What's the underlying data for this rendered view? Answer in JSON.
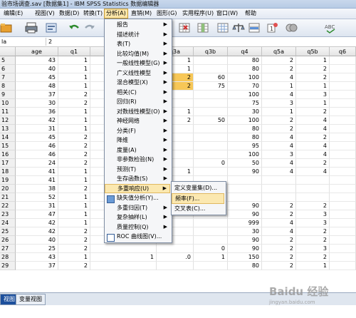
{
  "window": {
    "title": "验市场调查.sav [数据集1] - IBM SPSS Statistics 数据编辑器"
  },
  "menubar": [
    "编辑(E)",
    "视图(V)",
    "数据(D)",
    "转换(T)",
    "分析(A)",
    "直销(M)",
    "图形(G)",
    "实用程序(U)",
    "窗口(W)",
    "帮助"
  ],
  "cell_editor": {
    "name": "la",
    "value": "2"
  },
  "columns": [
    "age",
    "q1",
    "",
    "q3a",
    "q3b",
    "q4",
    "q5a",
    "q5b",
    "q6"
  ],
  "rows": [
    {
      "n": "5",
      "v": [
        "43",
        "1",
        "",
        "1",
        "",
        "80",
        "2",
        "1",
        ""
      ]
    },
    {
      "n": "6",
      "v": [
        "40",
        "1",
        "",
        "1",
        "",
        "80",
        "2",
        "2",
        ""
      ]
    },
    {
      "n": "7",
      "v": [
        "45",
        "1",
        "",
        "2",
        "60",
        "100",
        "4",
        "2",
        ""
      ]
    },
    {
      "n": "8",
      "v": [
        "48",
        "1",
        "",
        "2",
        "75",
        "70",
        "1",
        "1",
        ""
      ]
    },
    {
      "n": "9",
      "v": [
        "37",
        "2",
        "",
        "",
        "",
        "100",
        "4",
        "3",
        ""
      ]
    },
    {
      "n": "10",
      "v": [
        "30",
        "2",
        "",
        "",
        "",
        "75",
        "3",
        "1",
        ""
      ]
    },
    {
      "n": "11",
      "v": [
        "36",
        "1",
        "",
        "1",
        "",
        "30",
        "1",
        "2",
        ""
      ]
    },
    {
      "n": "12",
      "v": [
        "42",
        "1",
        "",
        "2",
        "50",
        "100",
        "2",
        "4",
        ""
      ]
    },
    {
      "n": "13",
      "v": [
        "31",
        "1",
        "",
        "",
        "",
        "80",
        "2",
        "4",
        ""
      ]
    },
    {
      "n": "14",
      "v": [
        "45",
        "2",
        "",
        "",
        "",
        "80",
        "4",
        "2",
        ""
      ]
    },
    {
      "n": "15",
      "v": [
        "46",
        "2",
        "",
        "",
        "",
        "95",
        "4",
        "4",
        ""
      ]
    },
    {
      "n": "16",
      "v": [
        "46",
        "2",
        "",
        "",
        "",
        "100",
        "3",
        "4",
        ""
      ]
    },
    {
      "n": "17",
      "v": [
        "24",
        "2",
        "",
        "",
        "0",
        "50",
        "4",
        "2",
        ""
      ]
    },
    {
      "n": "18",
      "v": [
        "41",
        "1",
        "",
        "1",
        "",
        "90",
        "4",
        "4",
        ""
      ]
    },
    {
      "n": "19",
      "v": [
        "41",
        "1",
        "",
        "",
        "",
        "",
        "",
        "",
        ""
      ]
    },
    {
      "n": "20",
      "v": [
        "38",
        "2",
        "",
        "",
        "",
        "",
        "",
        "",
        ""
      ]
    },
    {
      "n": "21",
      "v": [
        "52",
        "1",
        "",
        "",
        "",
        "",
        "",
        "",
        ""
      ]
    },
    {
      "n": "22",
      "v": [
        "31",
        "1",
        "",
        "",
        "",
        "90",
        "2",
        "2",
        ""
      ]
    },
    {
      "n": "23",
      "v": [
        "47",
        "1",
        "",
        "",
        "",
        "90",
        "2",
        "3",
        ""
      ]
    },
    {
      "n": "24",
      "v": [
        "42",
        "1",
        "",
        "",
        "",
        "999",
        "4",
        "3",
        ""
      ]
    },
    {
      "n": "25",
      "v": [
        "42",
        "2",
        "",
        "",
        "",
        "30",
        "4",
        "2",
        ""
      ]
    },
    {
      "n": "26",
      "v": [
        "40",
        "2",
        "1",
        "",
        "",
        "90",
        "2",
        "2",
        ""
      ]
    },
    {
      "n": "27",
      "v": [
        "25",
        "2",
        "",
        "",
        "0",
        "90",
        "2",
        "3",
        ""
      ]
    },
    {
      "n": "28",
      "v": [
        "43",
        "1",
        "1",
        ".0",
        "1",
        "150",
        "2",
        "2",
        ""
      ]
    },
    {
      "n": "29",
      "v": [
        "37",
        "2",
        "",
        "",
        "",
        "80",
        "2",
        "1",
        ""
      ]
    }
  ],
  "analysis_menu": [
    {
      "label": "报告",
      "sub": true
    },
    {
      "label": "描述统计",
      "sub": true
    },
    {
      "label": "表(T)",
      "sub": true
    },
    {
      "label": "比较均值(M)",
      "sub": true
    },
    {
      "label": "一般线性模型(G)",
      "sub": true
    },
    {
      "label": "广义线性模型",
      "sub": true
    },
    {
      "label": "混合模型(X)",
      "sub": true
    },
    {
      "label": "相关(C)",
      "sub": true
    },
    {
      "label": "回归(R)",
      "sub": true
    },
    {
      "label": "对数线性模型(O)",
      "sub": true
    },
    {
      "label": "神经网络",
      "sub": true
    },
    {
      "label": "分类(F)",
      "sub": true
    },
    {
      "label": "降维",
      "sub": true
    },
    {
      "label": "度量(A)",
      "sub": true
    },
    {
      "label": "非参数检验(N)",
      "sub": true
    },
    {
      "label": "预测(T)",
      "sub": true
    },
    {
      "label": "生存函数(S)",
      "sub": true
    },
    {
      "label": "多重响应(U)",
      "sub": true,
      "selected": true
    },
    {
      "label": "缺失值分析(Y)...",
      "sub": false
    },
    {
      "label": "多重归因(T)",
      "sub": true
    },
    {
      "label": "复杂抽样(L)",
      "sub": true
    },
    {
      "label": "质量控制(Q)",
      "sub": true
    },
    {
      "label": "ROC 曲线图(V)...",
      "sub": false
    }
  ],
  "multiple_response_menu": [
    {
      "label": "定义变量集(D)..."
    },
    {
      "label": "频率(F)...",
      "selected": true
    },
    {
      "label": "交叉表(C)..."
    }
  ],
  "tabs": [
    "视图",
    "变量视图"
  ],
  "watermark": "Baidu 经验",
  "watermark_url": "jingyan.baidu.com"
}
